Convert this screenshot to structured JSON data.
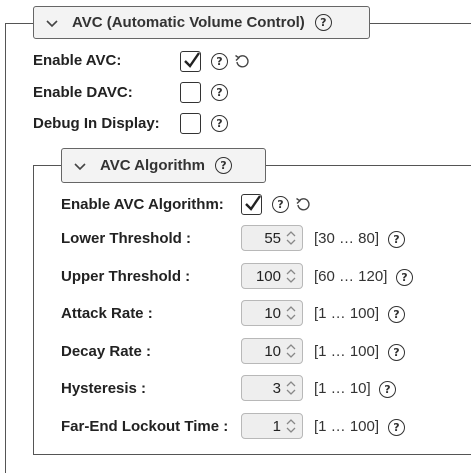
{
  "avc_section": {
    "title": "AVC (Automatic Volume Control)",
    "expanded": true,
    "fields": [
      {
        "label": "Enable AVC:",
        "checked": true,
        "has_reset": true
      },
      {
        "label": "Enable DAVC:",
        "checked": false,
        "has_reset": false
      },
      {
        "label": "Debug In Display:",
        "checked": false,
        "has_reset": false
      }
    ]
  },
  "algorithm_section": {
    "title": "AVC Algorithm",
    "expanded": true,
    "enable": {
      "label": "Enable AVC Algorithm:",
      "checked": true,
      "has_reset": true
    },
    "params": [
      {
        "label": "Lower Threshold :",
        "value": "55",
        "range": "[30 … 80]"
      },
      {
        "label": "Upper Threshold :",
        "value": "100",
        "range": "[60 … 120]"
      },
      {
        "label": "Attack Rate :",
        "value": "10",
        "range": "[1 … 100]"
      },
      {
        "label": "Decay Rate :",
        "value": "10",
        "range": "[1 … 100]"
      },
      {
        "label": "Hysteresis :",
        "value": "3",
        "range": "[1 … 10]"
      },
      {
        "label": "Far-End Lockout Time :",
        "value": "1",
        "range": "[1 … 100]"
      }
    ]
  },
  "icons": {
    "help": "?",
    "help_icon": "help-circle-icon",
    "reset_icon": "reset-icon",
    "chevron_icon": "chevron-down-icon",
    "spinner_icon": "spinner-arrows-icon"
  },
  "colors": {
    "border": "#555555",
    "header_bg": "#f3f3f3",
    "spin_bg": "#eeeeee"
  }
}
